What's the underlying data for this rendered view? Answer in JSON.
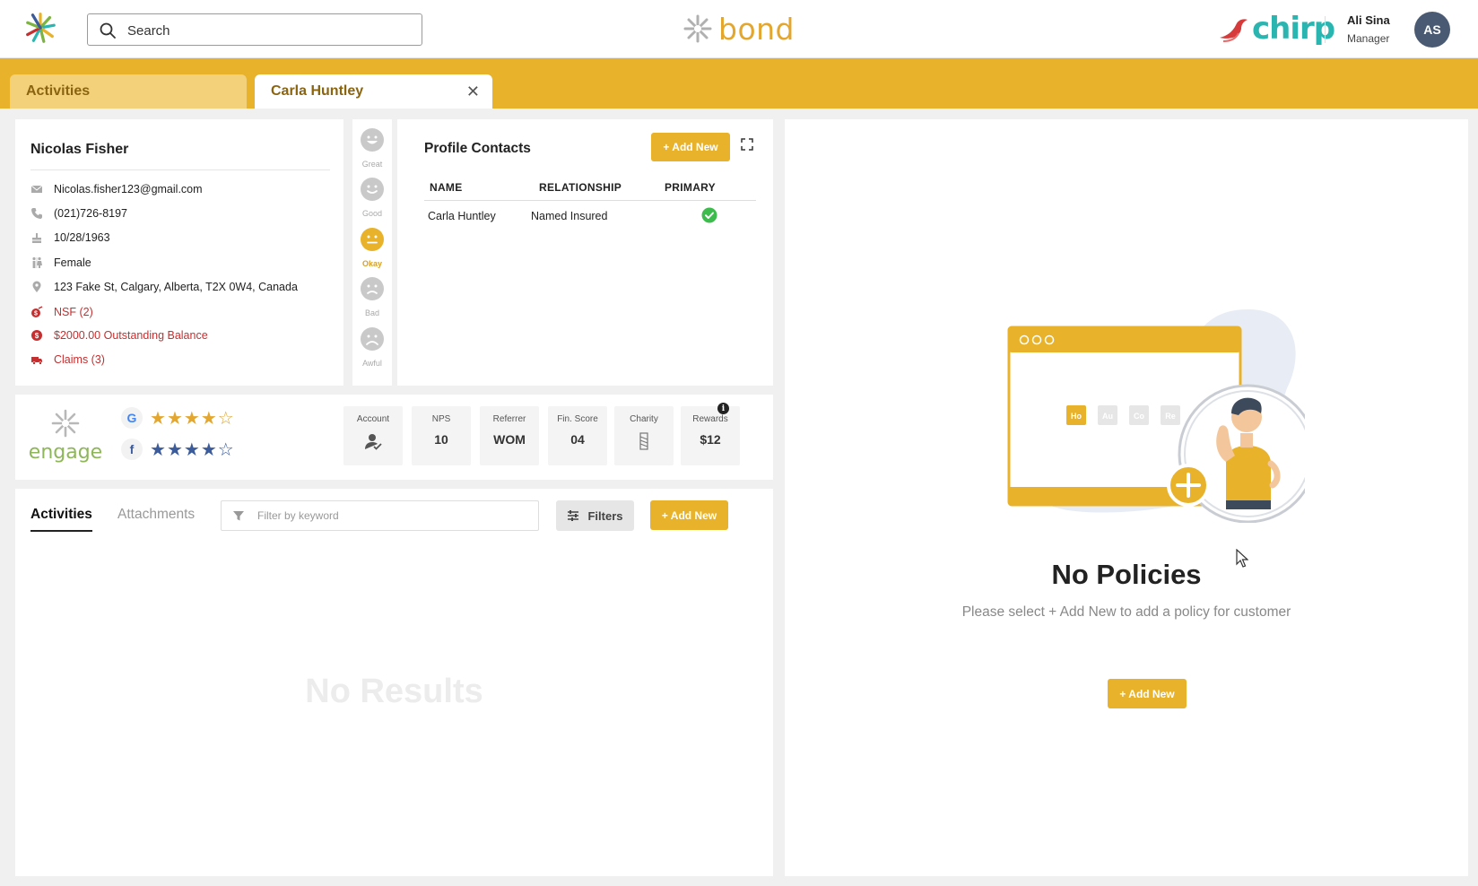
{
  "header": {
    "search_placeholder": "Search",
    "brand": "bond",
    "partner": "chirp",
    "user_name": "Ali Sina",
    "user_role": "Manager",
    "avatar_initials": "AS"
  },
  "tabs": [
    {
      "label": "Activities",
      "active": false
    },
    {
      "label": "Carla Huntley",
      "active": true,
      "closable": true
    }
  ],
  "profile": {
    "name": "Nicolas Fisher",
    "email": "Nicolas.fisher123@gmail.com",
    "phone": "(021)726-8197",
    "dob": "10/28/1963",
    "gender": "Female",
    "address": "123 Fake St, Calgary, Alberta, T2X 0W4, Canada",
    "nsf": "NSF (2)",
    "balance": "$2000.00 Outstanding Balance",
    "claims": "Claims (3)",
    "alert_color": "#c62f2f"
  },
  "mood": {
    "options": [
      "Great",
      "Good",
      "Okay",
      "Bad",
      "Awful"
    ],
    "selected": "Okay"
  },
  "contacts": {
    "title": "Profile Contacts",
    "add_label": "+ Add New",
    "columns": [
      "NAME",
      "RELATIONSHIP",
      "PRIMARY"
    ],
    "rows": [
      {
        "name": "Carla Huntley",
        "relationship": "Named Insured",
        "primary": true
      }
    ]
  },
  "engage": {
    "label": "engage",
    "ratings": [
      {
        "source": "G",
        "stars": 4,
        "out_of": 5,
        "color": "#e3a72f"
      },
      {
        "source": "f",
        "stars": 4,
        "out_of": 5,
        "color": "#3b5b9a"
      }
    ],
    "metrics": [
      {
        "label": "Account",
        "icon": "account-check-icon"
      },
      {
        "label": "NPS",
        "value": "10"
      },
      {
        "label": "Referrer",
        "value": "WOM"
      },
      {
        "label": "Fin. Score",
        "value": "04"
      },
      {
        "label": "Charity",
        "icon": "charity-icon"
      },
      {
        "label": "Rewards",
        "value": "$12"
      }
    ]
  },
  "activities": {
    "tabs": [
      "Activities",
      "Attachments"
    ],
    "active_tab": "Activities",
    "filter_placeholder": "Filter by keyword",
    "filters_label": "Filters",
    "add_label": "+ Add New",
    "empty_text": "No Results"
  },
  "policies": {
    "illustration_chips": [
      "Ho",
      "Au",
      "Co",
      "Re"
    ],
    "title": "No Policies",
    "subtitle": "Please select + Add New to add a policy for customer",
    "add_label": "+ Add New"
  },
  "colors": {
    "accent": "#e8b22a",
    "accent_light": "#f3d17a",
    "success": "#3dbb4c",
    "avatar_bg": "#4a5a72"
  }
}
